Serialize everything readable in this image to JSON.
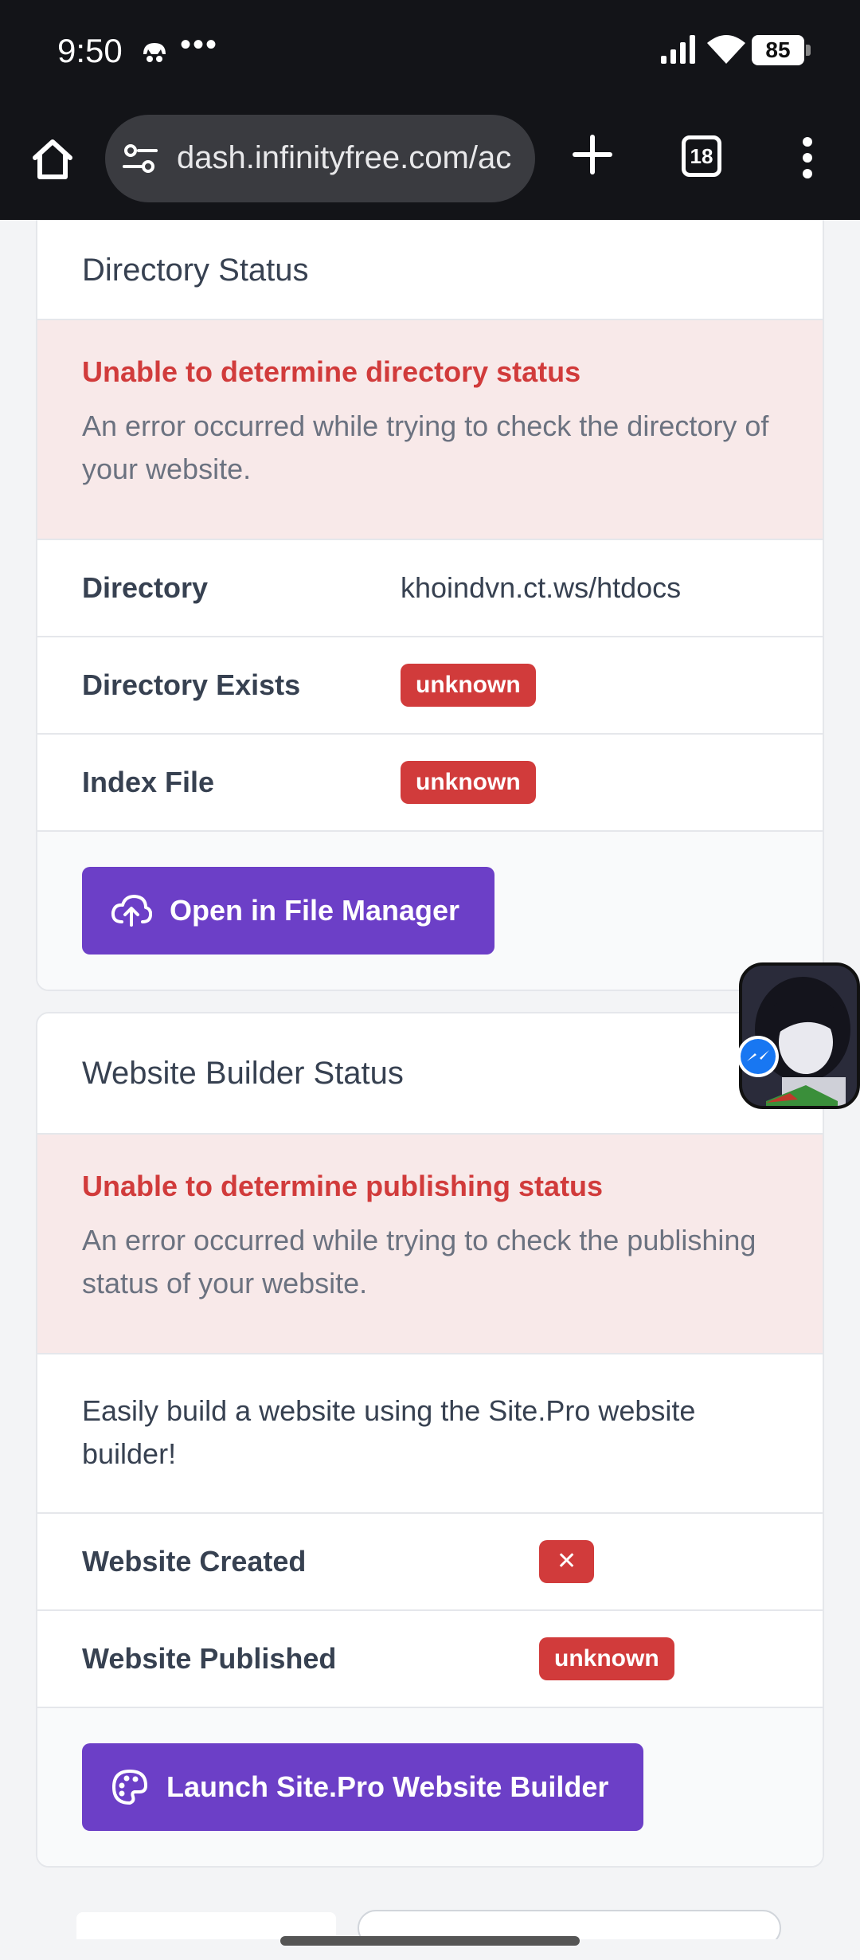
{
  "status_bar": {
    "time": "9:50",
    "more": "•••",
    "battery": "85",
    "icons": [
      "notification-icon",
      "signal-icon",
      "wifi-icon",
      "battery-icon"
    ]
  },
  "browser": {
    "url": "dash.infinityfree.com/ac",
    "tab_count": "18",
    "icons": [
      "home-icon",
      "site-info-icon",
      "new-tab-icon",
      "tabs-icon",
      "menu-icon"
    ]
  },
  "directory_card": {
    "title": "Directory Status",
    "alert_title": "Unable to determine directory status",
    "alert_message": "An error occurred while trying to check the directory of your website.",
    "rows": [
      {
        "label": "Directory",
        "value": "khoindvn.ct.ws/htdocs"
      },
      {
        "label": "Directory Exists",
        "badge": "unknown"
      },
      {
        "label": "Index File",
        "badge": "unknown"
      }
    ],
    "button_label": "Open in File Manager",
    "button_icon": "cloud-upload-icon"
  },
  "builder_card": {
    "title": "Website Builder Status",
    "alert_title": "Unable to determine publishing status",
    "alert_message": "An error occurred while trying to check the publishing status of your website.",
    "description": "Easily build a website using the Site.Pro website builder!",
    "rows": [
      {
        "label": "Website Created",
        "badge": "✕"
      },
      {
        "label": "Website Published",
        "badge": "unknown"
      }
    ],
    "button_label": "Launch Site.Pro Website Builder",
    "button_icon": "palette-icon"
  },
  "colors": {
    "accent": "#6c3fc7",
    "danger": "#d13b3b",
    "alert_bg": "#f8e9e9",
    "chrome_bg": "#131418"
  }
}
